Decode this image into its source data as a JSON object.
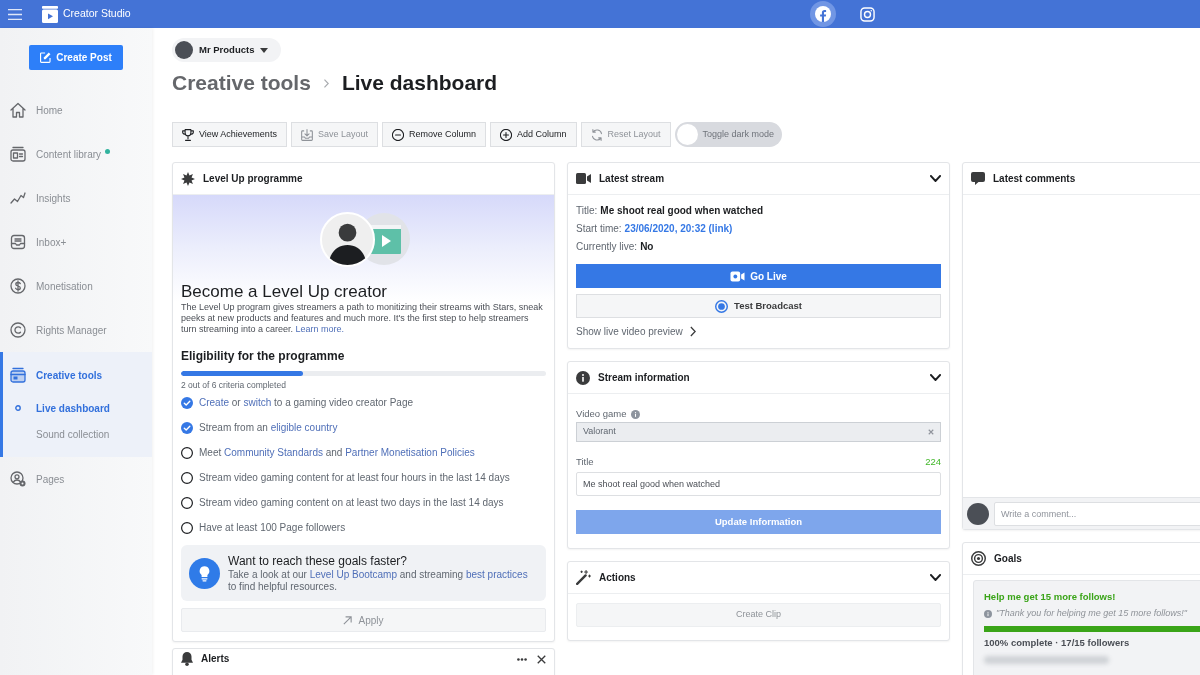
{
  "top_bar": {
    "app_title": "Creator Studio",
    "platforms": [
      {
        "selected": true
      },
      {
        "selected": false
      }
    ]
  },
  "sidebar": {
    "create_button": "Create Post",
    "items": [
      {
        "label": "Home",
        "selected": false,
        "notification": false
      },
      {
        "label": "Content library",
        "selected": false,
        "notification": true
      },
      {
        "label": "Insights",
        "selected": false,
        "notification": false
      },
      {
        "label": "Inbox+",
        "selected": false,
        "notification": false
      },
      {
        "label": "Monetisation",
        "selected": false,
        "notification": false
      },
      {
        "label": "Rights Manager",
        "selected": false,
        "notification": false
      },
      {
        "label": "Creative tools",
        "selected": true,
        "notification": false,
        "expanded": true,
        "children": [
          {
            "label": "Live dashboard",
            "selected": true
          },
          {
            "label": "Sound collection",
            "selected": false
          }
        ]
      },
      {
        "label": "Pages",
        "selected": false,
        "notification": false
      }
    ]
  },
  "header": {
    "page_selector": "Mr Products",
    "breadcrumb": [
      "Creative tools",
      "Live dashboard"
    ]
  },
  "toolbar": {
    "buttons": [
      {
        "label": "View Achievements",
        "disabled": false
      },
      {
        "label": "Save Layout",
        "disabled": true
      },
      {
        "label": "Remove Column",
        "disabled": false
      },
      {
        "label": "Add Column",
        "disabled": false
      },
      {
        "label": "Reset Layout",
        "disabled": true
      }
    ],
    "dark_mode": {
      "label": "Toggle dark mode",
      "on": false
    }
  },
  "level_up": {
    "title": "Level Up programme",
    "heading": "Become a Level Up creator",
    "description": [
      {
        "kind": "text",
        "text": "The Level Up program gives streamers a path to monitizing their streams with Stars, sneak peeks at new products and features and much more. It's the first step to help streamers turn streaming into a career. "
      },
      {
        "kind": "link",
        "text": "Learn more."
      }
    ],
    "eligibility": {
      "title": "Eligibility for the programme",
      "level": 0.333,
      "progress_text": "2 out of 6 criteria completed",
      "criteria": [
        {
          "checked": true,
          "parts": [
            {
              "kind": "link",
              "text": "Create"
            },
            {
              "kind": "text",
              "text": " or "
            },
            {
              "kind": "link",
              "text": "switch"
            },
            {
              "kind": "text",
              "text": " to a gaming video creator Page"
            }
          ]
        },
        {
          "checked": true,
          "parts": [
            {
              "kind": "text",
              "text": "Stream from an "
            },
            {
              "kind": "link",
              "text": "eligible country"
            }
          ]
        },
        {
          "checked": false,
          "parts": [
            {
              "kind": "text",
              "text": "Meet "
            },
            {
              "kind": "link",
              "text": "Community Standards"
            },
            {
              "kind": "text",
              "text": " and "
            },
            {
              "kind": "link",
              "text": "Partner Monetisation Policies"
            }
          ]
        },
        {
          "checked": false,
          "parts": [
            {
              "kind": "text",
              "text": "Stream video gaming content for at least four hours in the last 14 days"
            }
          ]
        },
        {
          "checked": false,
          "parts": [
            {
              "kind": "text",
              "text": "Stream video gaming content on at least two days in the last 14 days"
            }
          ]
        },
        {
          "checked": false,
          "parts": [
            {
              "kind": "text",
              "text": "Have at least 100 Page followers"
            }
          ]
        }
      ]
    },
    "tip": {
      "title": "Want to reach these goals faster?",
      "parts": [
        {
          "kind": "text",
          "text": "Take a look at our "
        },
        {
          "kind": "link",
          "text": "Level Up Bootcamp"
        },
        {
          "kind": "text",
          "text": " and streaming "
        },
        {
          "kind": "link",
          "text": "best practices"
        },
        {
          "kind": "text",
          "text": " to find helpful resources."
        }
      ]
    },
    "apply_button": {
      "label": "Apply",
      "disabled": true
    }
  },
  "alerts": {
    "title": "Alerts"
  },
  "latest_stream": {
    "title": "Latest stream",
    "details": [
      {
        "label": "Title:",
        "value": "Me shoot real good when watched",
        "kind": "text"
      },
      {
        "label": "Start time:",
        "value": "23/06/2020, 20:32 (link)",
        "kind": "link"
      },
      {
        "label": "Currently live:",
        "value": "No",
        "kind": "text"
      }
    ],
    "go_live_button": "Go Live",
    "test_broadcast_button": "Test Broadcast",
    "preview_link": "Show live video preview"
  },
  "stream_information": {
    "title": "Stream information",
    "video_game": {
      "label": "Video game",
      "value": "Valorant"
    },
    "title_field": {
      "label": "Title",
      "counter": "224",
      "value": "Me shoot real good when watched"
    },
    "update_button": {
      "label": "Update Information",
      "disabled": true
    }
  },
  "actions": {
    "title": "Actions",
    "create_clip_button": {
      "label": "Create Clip",
      "disabled": true
    }
  },
  "latest_comments": {
    "title": "Latest comments",
    "comment_field": {
      "placeholder": "Write a comment..."
    }
  },
  "goals": {
    "title": "Goals",
    "goal": {
      "title": "Help me get 15 more follows!",
      "message": "\"Thank you for helping me get 15 more follows!\"",
      "level": 1,
      "status": "100% complete · 17/15 followers"
    }
  }
}
